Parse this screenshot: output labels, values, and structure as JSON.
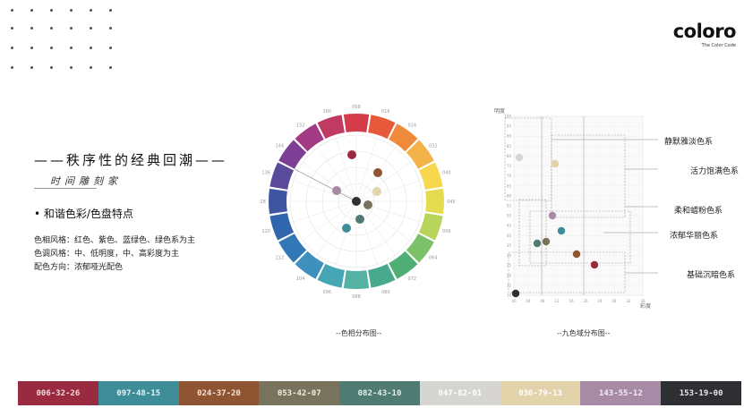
{
  "brand": {
    "name": "coloro",
    "tagline": "The Color Code"
  },
  "title": "——秩序性的经典回潮——",
  "subtitle": "时间雕刻家",
  "bullet": "• 和谐色彩/色盘特点",
  "properties": [
    "色相风格：红色、紫色、蓝绿色、绿色系为主",
    "色调风格：中、低明度，中、高彩度为主",
    "配色方向：浓郁哑光配色"
  ],
  "hue_wheel": {
    "caption": "--色相分布图--",
    "ring_labels": [
      "008",
      "016",
      "024",
      "032",
      "040",
      "048",
      "056",
      "064",
      "072",
      "080",
      "088",
      "096",
      "104",
      "112",
      "120",
      "128",
      "136",
      "144",
      "152",
      "160"
    ],
    "segment_colors": [
      "#d33c48",
      "#e65a3a",
      "#ef8a3a",
      "#f4b24a",
      "#f7d84c",
      "#e2dc4e",
      "#b9d45a",
      "#7cc16a",
      "#4fae74",
      "#48a98c",
      "#53b2a4",
      "#46a6b3",
      "#3e90bd",
      "#3378b6",
      "#3166ae",
      "#3e55a2",
      "#5a4a9c",
      "#7c3f95",
      "#a23a84",
      "#c03a63"
    ]
  },
  "value_chroma": {
    "caption": "--九色域分布图--",
    "y_axis_title": "明度",
    "x_axis_title": "彩度",
    "y_ticks": [
      "100",
      "95",
      "90",
      "85",
      "80",
      "75",
      "70",
      "65",
      "60",
      "55",
      "50",
      "45",
      "40",
      "35",
      "30",
      "25",
      "20",
      "15",
      "10"
    ],
    "x_ticks": [
      "00",
      "04",
      "08",
      "12",
      "16",
      "20",
      "24",
      "28",
      "32",
      "36"
    ],
    "regions": [
      "静默雅淡色系",
      "活力饱满色系",
      "柔和蜡粉色系",
      "浓郁华丽色系",
      "基础沉暗色系"
    ]
  },
  "swatches": [
    {
      "code": "006-32-26",
      "color": "#9a2a40",
      "text_color": "#f3d9dd"
    },
    {
      "code": "097-48-15",
      "color": "#3f8c99",
      "text_color": "#e4f3f5"
    },
    {
      "code": "024-37-20",
      "color": "#8f5533",
      "text_color": "#f6e2d4"
    },
    {
      "code": "053-42-07",
      "color": "#78735c",
      "text_color": "#efece2"
    },
    {
      "code": "082-43-10",
      "color": "#4f7b73",
      "text_color": "#e2f0ec"
    },
    {
      "code": "047-82-01",
      "color": "#d6d5d1",
      "text_color": "#ffffff"
    },
    {
      "code": "036-79-13",
      "color": "#e3d3ab",
      "text_color": "#ffffff"
    },
    {
      "code": "143-55-12",
      "color": "#a68aa6",
      "text_color": "#f6ecf5"
    },
    {
      "code": "153-19-00",
      "color": "#2e2f33",
      "text_color": "#e6e6e6"
    }
  ]
}
